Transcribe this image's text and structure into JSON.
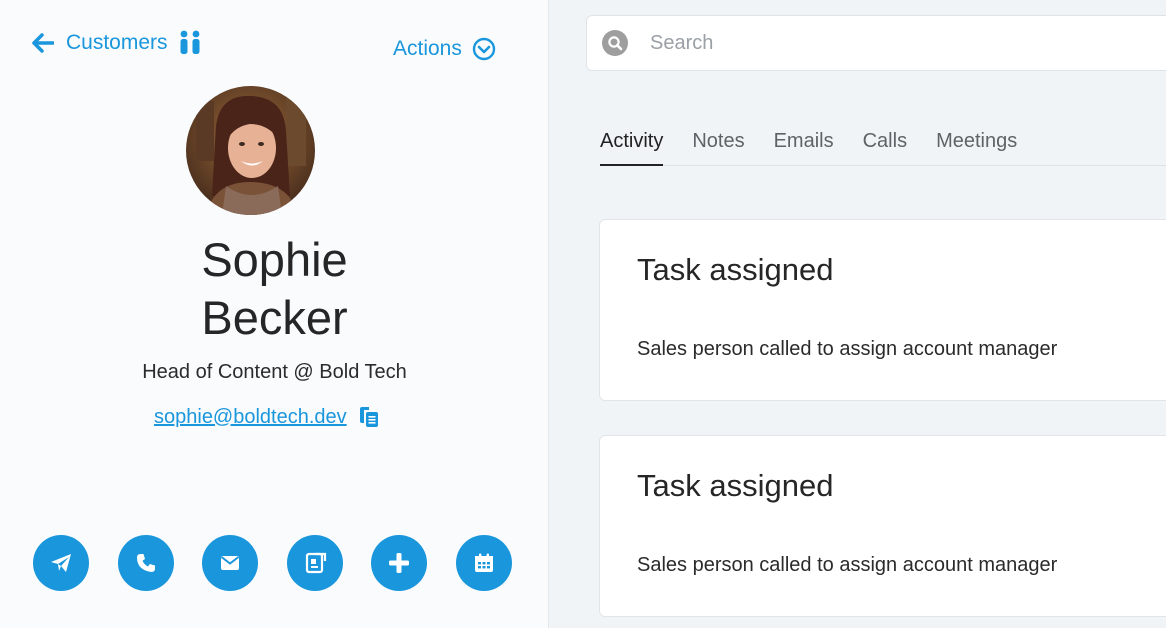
{
  "nav": {
    "back_label": "Customers",
    "actions_label": "Actions"
  },
  "profile": {
    "first_name": "Sophie",
    "last_name": "Becker",
    "role": "Head of Content @ Bold Tech",
    "email": "sophie@boldtech.dev"
  },
  "quick_actions": [
    "send-icon",
    "phone-icon",
    "mail-icon",
    "note-icon",
    "plus-icon",
    "calendar-icon"
  ],
  "search": {
    "placeholder": "Search",
    "value": ""
  },
  "tabs": [
    {
      "label": "Activity",
      "active": true
    },
    {
      "label": "Notes",
      "active": false
    },
    {
      "label": "Emails",
      "active": false
    },
    {
      "label": "Calls",
      "active": false
    },
    {
      "label": "Meetings",
      "active": false
    }
  ],
  "activity": [
    {
      "title": "Task assigned",
      "body": "Sales person called to assign account manager"
    },
    {
      "title": "Task assigned",
      "body": "Sales person called to assign account manager"
    }
  ],
  "colors": {
    "accent": "#1a96dc",
    "panel": "#f9fbfd",
    "background": "#f1f4f7"
  }
}
